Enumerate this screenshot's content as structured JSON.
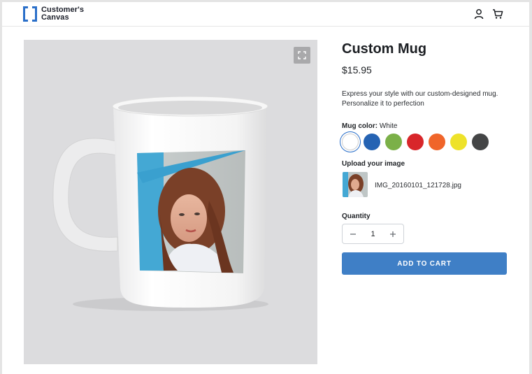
{
  "header": {
    "logo_line1": "Customer's",
    "logo_line2": "Canvas",
    "icons": [
      "user-icon",
      "cart-icon"
    ]
  },
  "gallery": {
    "expand_icon": "expand-icon"
  },
  "product": {
    "title": "Custom Mug",
    "price": "$15.95",
    "description": "Express your style with our custom-designed mug. Personalize it to perfection",
    "color_label": "Mug color:",
    "color_value": "White",
    "colors": [
      {
        "name": "white",
        "hex": "#ffffff",
        "selected": true
      },
      {
        "name": "blue",
        "hex": "#2563b3"
      },
      {
        "name": "green",
        "hex": "#7bb048"
      },
      {
        "name": "red",
        "hex": "#d8262a"
      },
      {
        "name": "orange",
        "hex": "#f0652a"
      },
      {
        "name": "yellow",
        "hex": "#eee22a"
      },
      {
        "name": "dark-gray",
        "hex": "#444546"
      }
    ],
    "upload_label": "Upload your image",
    "uploaded_filename": "IMG_20160101_121728.jpg",
    "quantity_label": "Quantity",
    "quantity": "1",
    "add_to_cart_label": "ADD TO CART"
  },
  "theme": {
    "accent": "#3f7fc6",
    "logo_blue": "#2a6fc9"
  }
}
